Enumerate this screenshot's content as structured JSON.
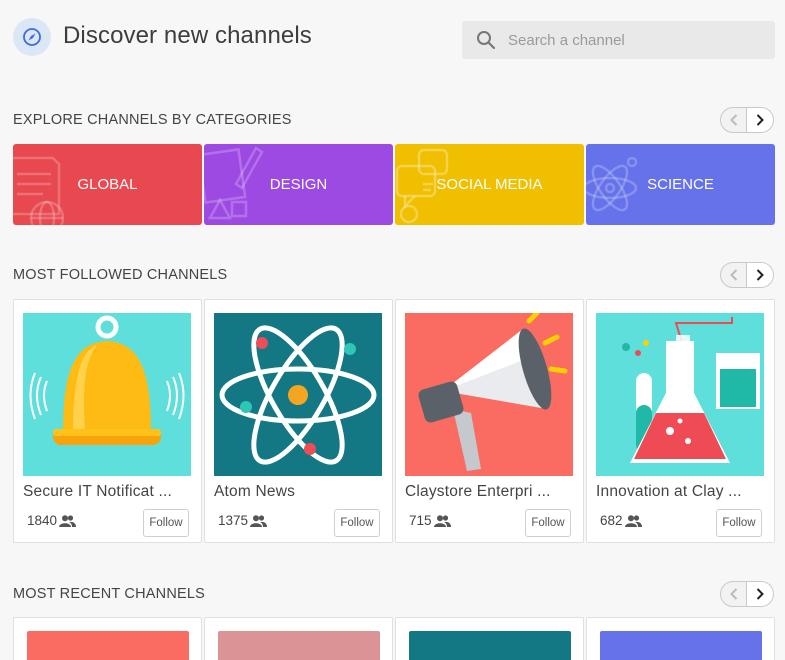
{
  "header": {
    "title": "Discover new channels",
    "search_placeholder": "Search a channel"
  },
  "sections": {
    "categories_title": "EXPLORE CHANNELS BY CATEGORIES",
    "followed_title": "MOST FOLLOWED CHANNELS",
    "recent_title": "MOST RECENT CHANNELS"
  },
  "categories": [
    {
      "label": "GLOBAL",
      "color": "#e8484f"
    },
    {
      "label": "DESIGN",
      "color": "#9d4ae3"
    },
    {
      "label": "SOCIAL MEDIA",
      "color": "#f0bf00"
    },
    {
      "label": "SCIENCE",
      "color": "#6672ea"
    }
  ],
  "followed_channels": [
    {
      "name": "Secure IT Notificat ...",
      "followers": "1840",
      "follow_label": "Follow",
      "thumb_color": "#5fdfdb",
      "icon": "bell-icon"
    },
    {
      "name": "Atom News",
      "followers": "1375",
      "follow_label": "Follow",
      "thumb_color": "#137784",
      "icon": "atom-icon"
    },
    {
      "name": "Claystore Enterpri ...",
      "followers": "715",
      "follow_label": "Follow",
      "thumb_color": "#fa6b61",
      "icon": "megaphone-icon"
    },
    {
      "name": "Innovation at Clay ...",
      "followers": "682",
      "follow_label": "Follow",
      "thumb_color": "#5fdfdb",
      "icon": "lab-flask-icon"
    }
  ],
  "recent_channels": [
    {
      "thumb_color": "#fa6b61"
    },
    {
      "thumb_color": "#db9395"
    },
    {
      "thumb_color": "#137784"
    },
    {
      "thumb_color": "#6672ea"
    }
  ]
}
